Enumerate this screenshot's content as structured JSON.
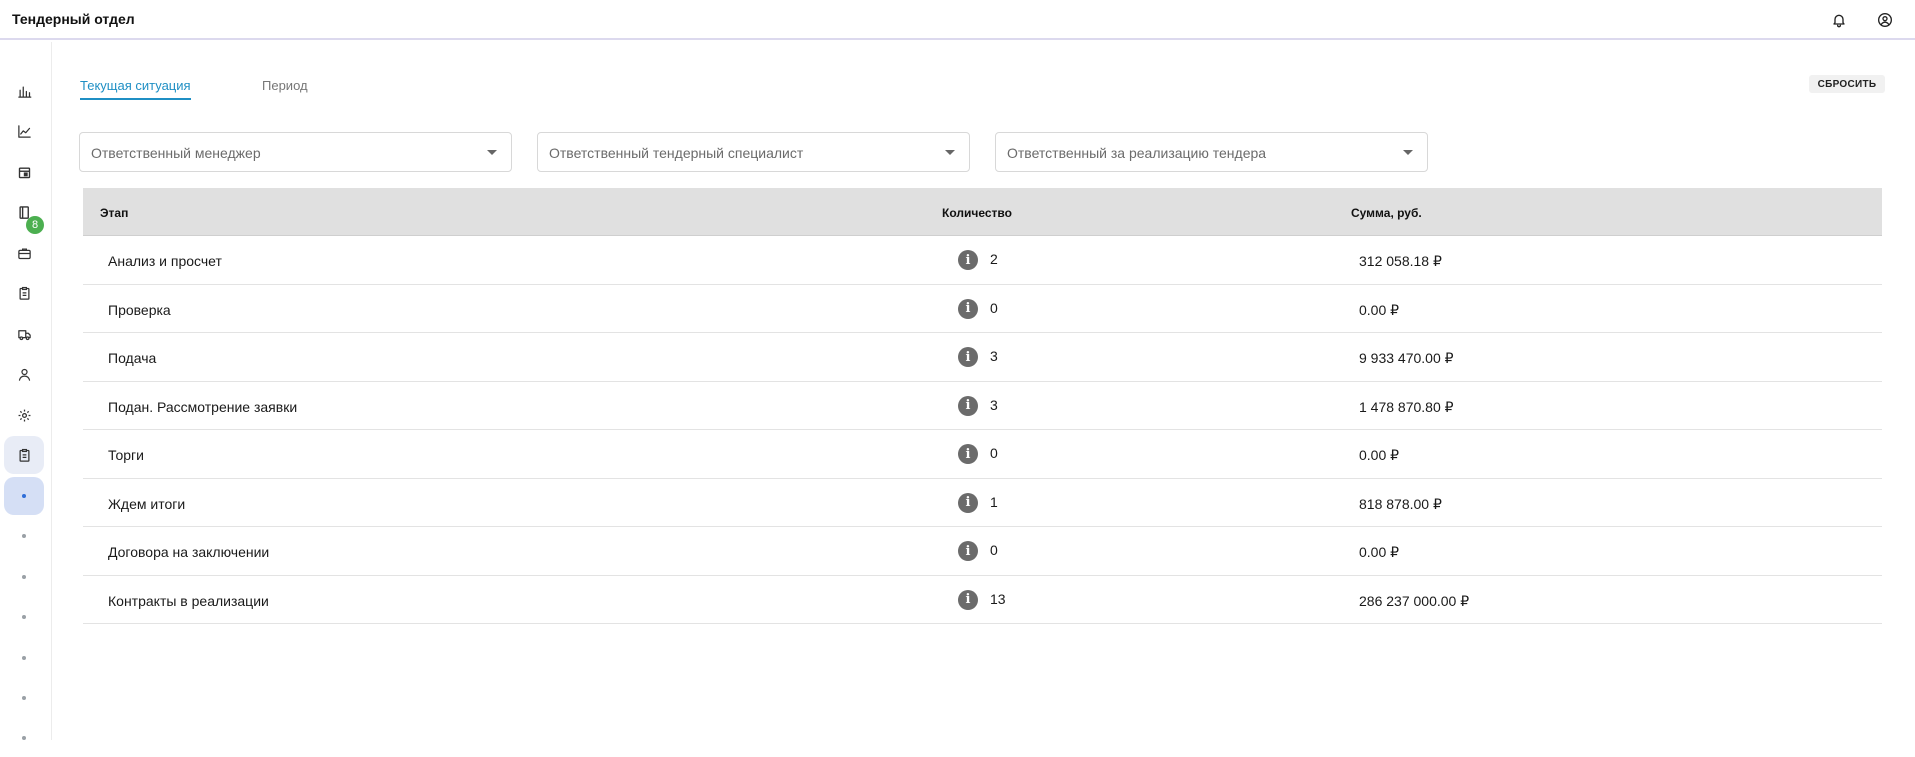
{
  "app": {
    "title": "Тендерный отдел"
  },
  "header": {
    "icons": [
      "bell-icon",
      "account-circle-icon"
    ]
  },
  "sidebar": {
    "badge": "8",
    "icons": [
      "bar-chart-icon",
      "line-chart-icon",
      "calendar-icon",
      "book-icon",
      "briefcase-icon",
      "clipboard-icon",
      "truck-icon",
      "user-icon",
      "settings-icon",
      "clipboard-icon"
    ]
  },
  "tabs": [
    {
      "label": "Текущая ситуация",
      "active": true
    },
    {
      "label": "Период",
      "active": false
    }
  ],
  "reset_label": "СБРОСИТЬ",
  "filters": [
    {
      "placeholder": "Ответственный менеджер"
    },
    {
      "placeholder": "Ответственный тендерный специалист"
    },
    {
      "placeholder": "Ответственный за реализацию тендера"
    }
  ],
  "table": {
    "columns": [
      "Этап",
      "Количество",
      "Сумма, руб."
    ],
    "rows": [
      {
        "stage": "Анализ и просчет",
        "count": "2",
        "sum": "312 058.18 ₽"
      },
      {
        "stage": "Проверка",
        "count": "0",
        "sum": "0.00 ₽"
      },
      {
        "stage": "Подача",
        "count": "3",
        "sum": "9 933 470.00 ₽"
      },
      {
        "stage": "Подан. Рассмотрение заявки",
        "count": "3",
        "sum": "1 478 870.80 ₽"
      },
      {
        "stage": "Торги",
        "count": "0",
        "sum": "0.00 ₽"
      },
      {
        "stage": "Ждем итоги",
        "count": "1",
        "sum": "818 878.00 ₽"
      },
      {
        "stage": "Договора на заключении",
        "count": "0",
        "sum": "0.00 ₽"
      },
      {
        "stage": "Контракты в реализации",
        "count": "13",
        "sum": "286 237 000.00 ₽"
      }
    ]
  },
  "colors": {
    "accent": "#1f8fc4",
    "badge": "#4caf50",
    "header_bg": "#e0e0e0"
  }
}
